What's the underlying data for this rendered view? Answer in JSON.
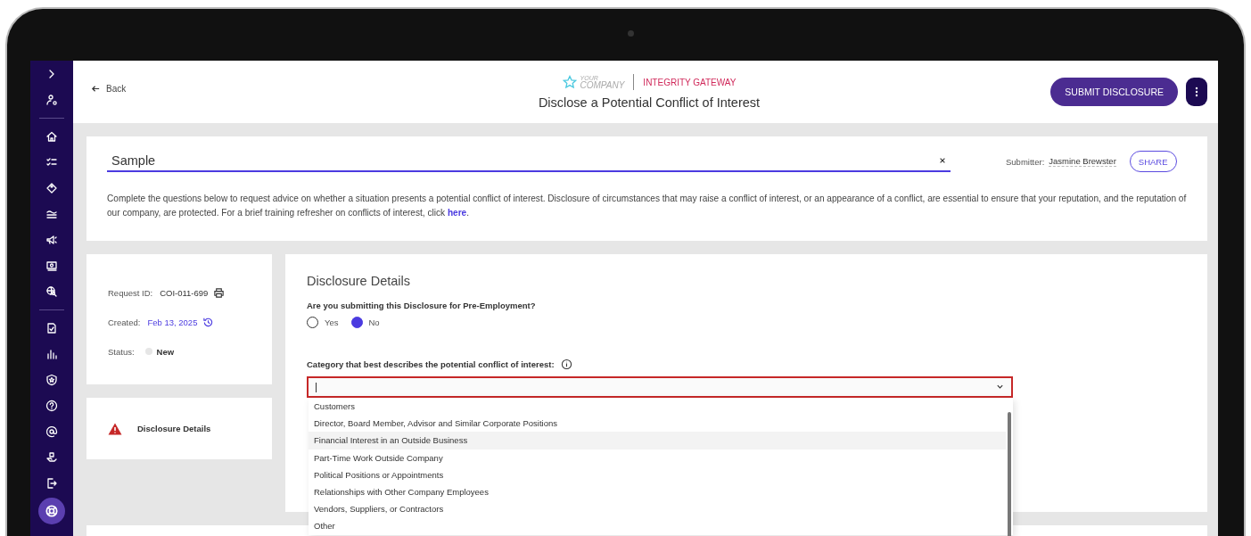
{
  "header": {
    "back_label": "Back",
    "logo_small": "YOUR",
    "logo_word": "COMPANY",
    "product": "INTEGRITY GATEWAY",
    "title": "Disclose a Potential Conflict of Interest",
    "submit_button": "SUBMIT DISCLOSURE"
  },
  "intro": {
    "title_value": "Sample",
    "submitter_label": "Submitter:",
    "submitter_name": "Jasmine Brewster",
    "share_button": "SHARE",
    "text_before": "Complete the questions below to request advice on whether a situation presents a potential conflict of interest. Disclosure of circumstances that may raise a conflict of interest, or an appearance of a conflict, are essential to ensure that your reputation, and the reputation of our company, are protected. For a brief training refresher on conflicts of interest, click ",
    "link": "here",
    "text_after": "."
  },
  "request": [
    {
      "label": "Request ID:",
      "value": "COI-011-699",
      "kind": "print"
    },
    {
      "label": "Created:",
      "value": "Feb 13, 2025",
      "kind": "history"
    },
    {
      "label": "Status:",
      "value": "New",
      "kind": "status"
    }
  ],
  "sections": [
    {
      "label": "Disclosure Details",
      "error": true
    }
  ],
  "form": {
    "heading": "Disclosure Details",
    "question": "Are you submitting this Disclosure for Pre-Employment?",
    "options": [
      {
        "label": "Yes",
        "selected": false
      },
      {
        "label": "No",
        "selected": true
      }
    ],
    "category_label": "Category that best describes the potential conflict of interest:",
    "error": true,
    "expanded": true,
    "choices": [
      {
        "label": "Customers",
        "highlighted": false
      },
      {
        "label": "Director, Board Member, Advisor and Similar Corporate Positions",
        "highlighted": false
      },
      {
        "label": "Financial Interest in an Outside Business",
        "highlighted": true
      },
      {
        "label": "Part-Time Work Outside Company",
        "highlighted": false
      },
      {
        "label": "Political Positions or Appointments",
        "highlighted": false
      },
      {
        "label": "Relationships with Other Company Employees",
        "highlighted": false
      },
      {
        "label": "Vendors, Suppliers, or Contractors",
        "highlighted": false
      },
      {
        "label": "Other",
        "highlighted": false
      }
    ]
  }
}
